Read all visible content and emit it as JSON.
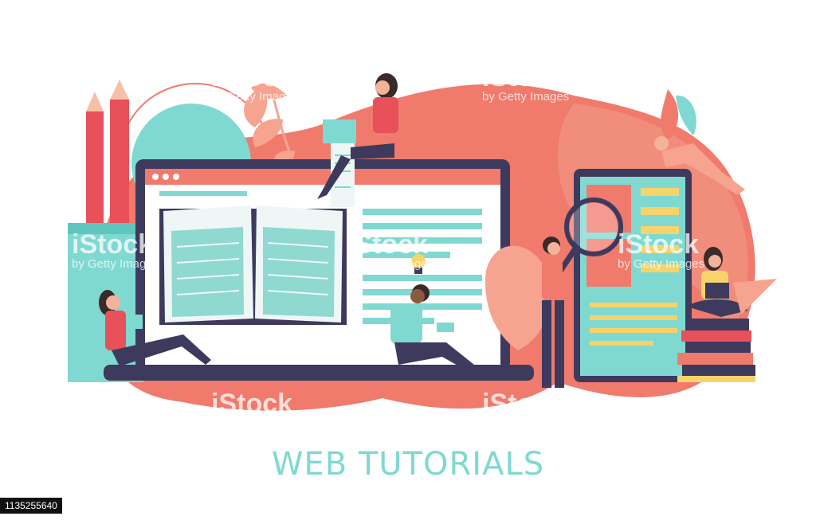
{
  "title": "WEB TUTORIALS",
  "watermark": {
    "brand": "iStock",
    "credit": "by Getty Images"
  },
  "stock_id": "1135255640",
  "colors": {
    "blob": "#f07a6c",
    "blob_light": "#f6a38f",
    "teal": "#7fd9d1",
    "navy": "#3d3a5e",
    "title": "#7fd9d1"
  },
  "icons": {
    "laptop": "laptop-icon",
    "tablet": "tablet-icon",
    "book": "open-book-icon",
    "pencils": "pencil-cup-icon",
    "magnifier": "magnifier-icon",
    "bulb": "lightbulb-icon"
  }
}
